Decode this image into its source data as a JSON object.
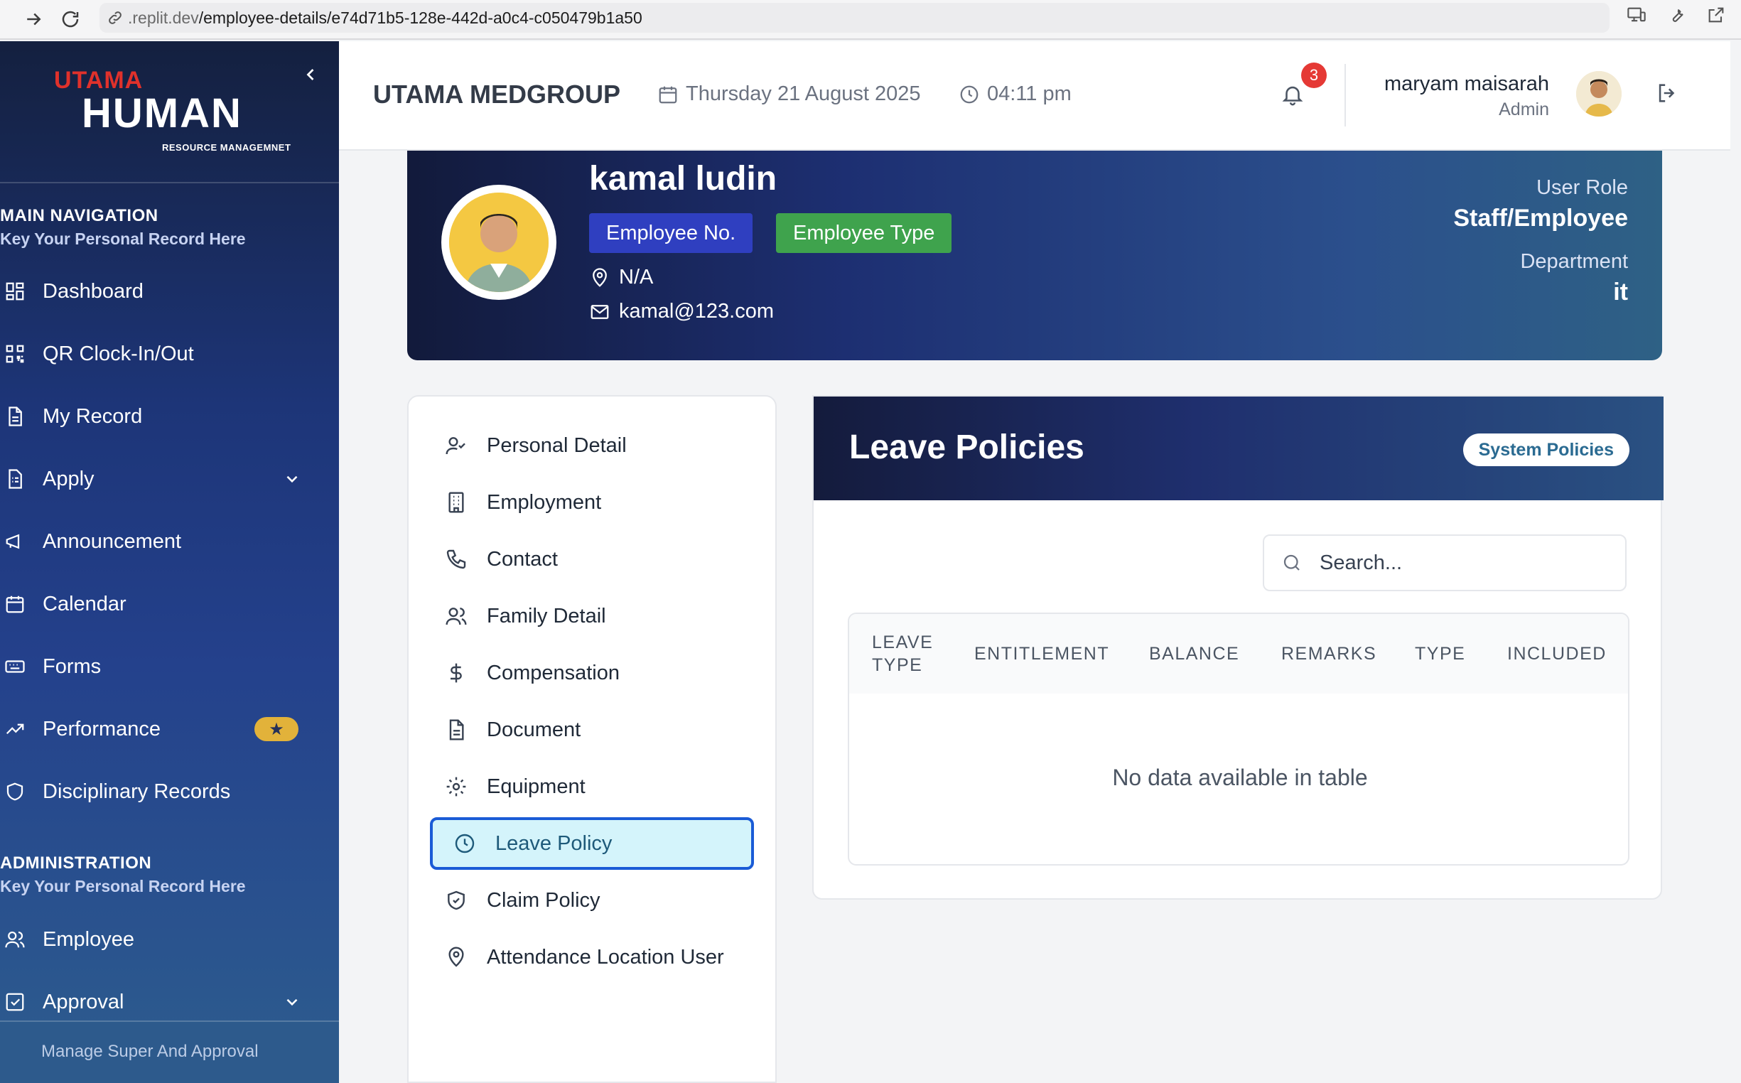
{
  "browser": {
    "url_host": ".replit.dev",
    "url_path": "/employee-details/e74d71b5-128e-442d-a0c4-c050479b1a50"
  },
  "sidebar": {
    "logo": {
      "top": "UTAMA",
      "main": "HUMAN",
      "sub": "RESOURCE MANAGEMNET"
    },
    "main_section": {
      "title": "MAIN NAVIGATION",
      "subtitle": "Key Your Personal Record Here"
    },
    "main_items": [
      {
        "label": "Dashboard",
        "icon": "dashboard-icon"
      },
      {
        "label": "QR Clock-In/Out",
        "icon": "qr-code-icon"
      },
      {
        "label": "My Record",
        "icon": "document-icon"
      },
      {
        "label": "Apply",
        "icon": "form-icon",
        "has_dropdown": true
      },
      {
        "label": "Announcement",
        "icon": "megaphone-icon"
      },
      {
        "label": "Calendar",
        "icon": "calendar-icon"
      },
      {
        "label": "Forms",
        "icon": "keyboard-icon"
      },
      {
        "label": "Performance",
        "icon": "trending-up-icon",
        "badge": "★"
      },
      {
        "label": "Disciplinary Records",
        "icon": "shield-icon"
      }
    ],
    "admin_section": {
      "title": "ADMINISTRATION",
      "subtitle": "Key Your Personal Record Here"
    },
    "admin_items": [
      {
        "label": "Employee",
        "icon": "users-icon"
      },
      {
        "label": "Approval",
        "icon": "checkbox-icon",
        "has_dropdown": true
      }
    ],
    "footer": "Manage Super And Approval"
  },
  "header": {
    "company": "UTAMA MEDGROUP",
    "date": "Thursday 21 August 2025",
    "time": "04:11 pm",
    "notification_count": "3",
    "user_name": "maryam maisarah",
    "user_role": "Admin"
  },
  "profile": {
    "name": "kamal ludin",
    "employee_no_label": "Employee No.",
    "employee_type_label": "Employee Type",
    "location": "N/A",
    "email": "kamal@123.com",
    "user_role_label": "User Role",
    "user_role_value": "Staff/Employee",
    "department_label": "Department",
    "department_value": "it"
  },
  "tabs": [
    {
      "label": "Personal Detail",
      "icon": "user-check-icon"
    },
    {
      "label": "Employment",
      "icon": "building-icon"
    },
    {
      "label": "Contact",
      "icon": "phone-icon"
    },
    {
      "label": "Family Detail",
      "icon": "users-icon"
    },
    {
      "label": "Compensation",
      "icon": "dollar-icon"
    },
    {
      "label": "Document",
      "icon": "file-icon"
    },
    {
      "label": "Equipment",
      "icon": "gear-icon"
    },
    {
      "label": "Leave Policy",
      "icon": "clock-icon",
      "active": true
    },
    {
      "label": "Claim Policy",
      "icon": "shield-check-icon"
    },
    {
      "label": "Attendance Location User",
      "icon": "map-pin-icon"
    }
  ],
  "policy": {
    "title": "Leave Policies",
    "pill": "System Policies",
    "search_placeholder": "Search...",
    "columns": [
      "LEAVE TYPE",
      "ENTITLEMENT",
      "BALANCE",
      "REMARKS",
      "TYPE",
      "INCLUDED"
    ],
    "empty_message": "No data available in table"
  },
  "colors": {
    "sidebar_top": "#14203f",
    "sidebar_bottom": "#2d5d8f",
    "badge_employee_no": "#2f3fc0",
    "badge_employee_type": "#3fa34d",
    "active_tab_bg": "#d4f4fb",
    "active_tab_border": "#1a5bd6",
    "notification_badge": "#e53935",
    "star_badge": "#e2b23a"
  }
}
